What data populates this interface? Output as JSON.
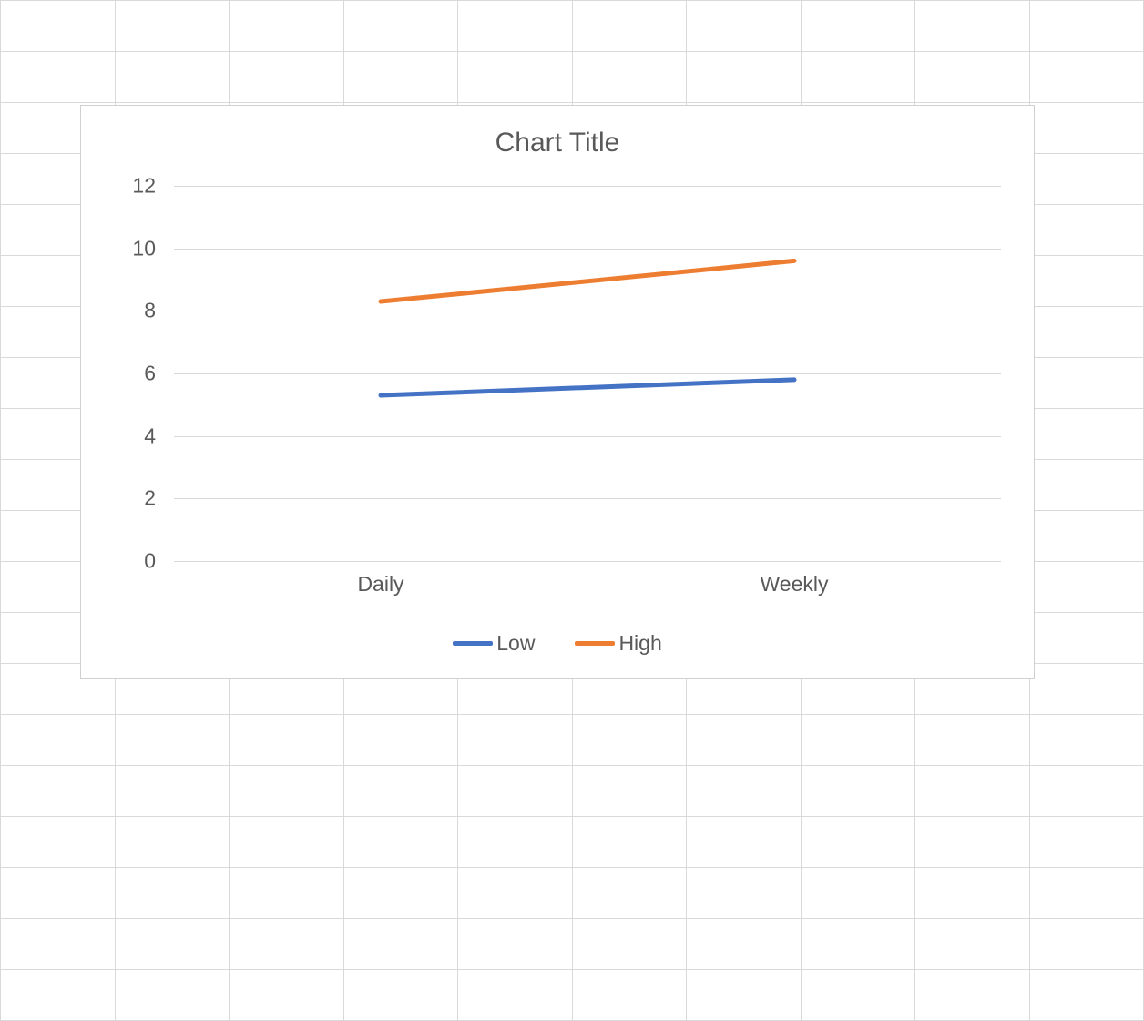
{
  "chart_data": {
    "type": "line",
    "title": "Chart Title",
    "categories": [
      "Daily",
      "Weekly"
    ],
    "series": [
      {
        "name": "Low",
        "color": "#4472C4",
        "values": [
          5.3,
          5.8
        ]
      },
      {
        "name": "High",
        "color": "#ED7D31",
        "values": [
          8.3,
          9.6
        ]
      }
    ],
    "ylim": [
      0,
      12
    ],
    "ystep": 2,
    "xlabel": "",
    "ylabel": ""
  },
  "y_ticks": [
    "0",
    "2",
    "4",
    "6",
    "8",
    "10",
    "12"
  ]
}
